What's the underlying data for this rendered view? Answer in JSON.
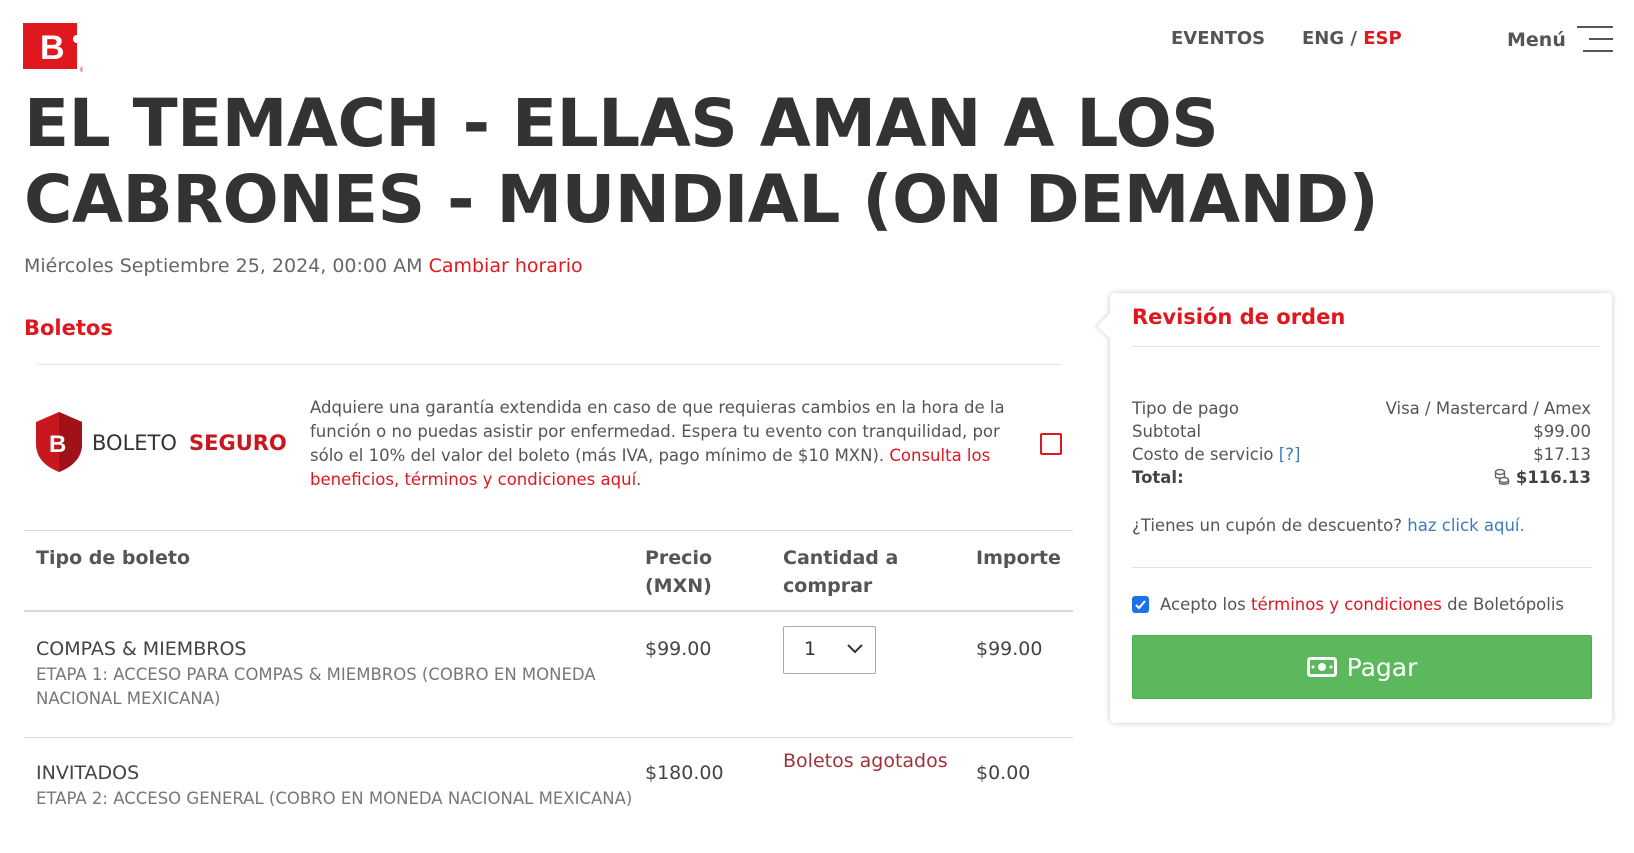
{
  "header": {
    "logo_letter": "B",
    "nav": {
      "eventos": "EVENTOS",
      "lang_eng": "ENG",
      "lang_sep": " / ",
      "lang_esp": "ESP",
      "menu": "Menú"
    },
    "brand_color": "#e0171f"
  },
  "event": {
    "title": "EL TEMACH - ELLAS AMAN A LOS CABRONES - MUNDIAL (ON DEMAND)",
    "date": "Miércoles Septiembre 25, 2024, 00:00 AM",
    "change_schedule": "Cambiar horario"
  },
  "tickets": {
    "section_title": "Boletos",
    "boleto_seguro": {
      "logo_text_light": "BOLETO",
      "logo_text_bold": "SEGURO",
      "description": "Adquiere una garantía extendida en caso de que requieras cambios en la hora de la función o no puedas asistir por enfermedad. Espera tu evento con tranquilidad, por sólo el 10% del valor del boleto (más IVA, pago mínimo de $10 MXN).",
      "link": "Consulta los beneficios, términos y condiciones aquí",
      "link_suffix": ".",
      "checked": false
    },
    "columns": {
      "type": "Tipo de boleto",
      "price_line1": "Precio",
      "price_line2": "(MXN)",
      "qty_line1": "Cantidad a",
      "qty_line2": "comprar",
      "amount": "Importe"
    },
    "rows": [
      {
        "name": "COMPAS & MIEMBROS",
        "description": "ETAPA 1: ACCESO PARA COMPAS & MIEMBROS (COBRO EN MONEDA NACIONAL MEXICANA)",
        "price": "$99.00",
        "quantity": "1",
        "amount": "$99.00"
      },
      {
        "name": "INVITADOS",
        "description": "ETAPA 2: ACCESO GENERAL (COBRO EN MONEDA NACIONAL MEXICANA)",
        "price": "$180.00",
        "status": "Boletos agotados",
        "amount": "$0.00"
      }
    ]
  },
  "order": {
    "title": "Revisión de orden",
    "payment_type_label": "Tipo de pago",
    "payment_type_value": "Visa / Mastercard / Amex",
    "subtotal_label": "Subtotal",
    "subtotal_value": "$99.00",
    "service_label": "Costo de servicio",
    "service_help": "[?]",
    "service_value": "$17.13",
    "total_label": "Total:",
    "total_value": "$116.13",
    "coupon_text": "¿Tienes un cupón de descuento?",
    "coupon_link": "haz click aquí.",
    "terms_prefix": "Acepto los",
    "terms_link": "términos y condiciones",
    "terms_suffix": "de Boletópolis",
    "terms_checked": true,
    "pay_button": "Pagar",
    "pay_color": "#5cb85c"
  }
}
